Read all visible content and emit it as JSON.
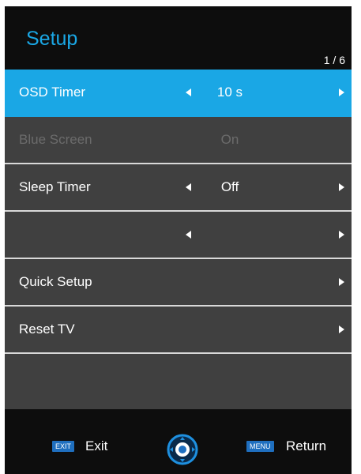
{
  "header": {
    "title": "Setup",
    "page_indicator": "1 / 6"
  },
  "menu": {
    "rows": [
      {
        "label": "OSD Timer",
        "value": "10 s",
        "state": "selected"
      },
      {
        "label": "Blue Screen",
        "value": "On",
        "state": "disabled"
      },
      {
        "label": "Sleep Timer",
        "value": "Off",
        "state": "normal"
      },
      {
        "label": "",
        "value": "",
        "state": "normal"
      },
      {
        "label": "Quick Setup",
        "value": "",
        "state": "normal"
      },
      {
        "label": "Reset TV",
        "value": "",
        "state": "normal"
      },
      {
        "label": "",
        "value": "",
        "state": "empty"
      }
    ]
  },
  "footer": {
    "exit_key": "EXIT",
    "exit_label": "Exit",
    "menu_key": "MENU",
    "return_label": "Return"
  },
  "colors": {
    "accent": "#1aa7e5",
    "panel": "#404040",
    "header": "#0d0d0d",
    "divider": "#d9d9d9",
    "disabled_text": "#6b6b6b",
    "key_badge": "#1f6fbf"
  },
  "icons": {
    "left": "triangle-left-icon",
    "right": "triangle-right-icon",
    "nav": "navigation-dpad-icon"
  }
}
